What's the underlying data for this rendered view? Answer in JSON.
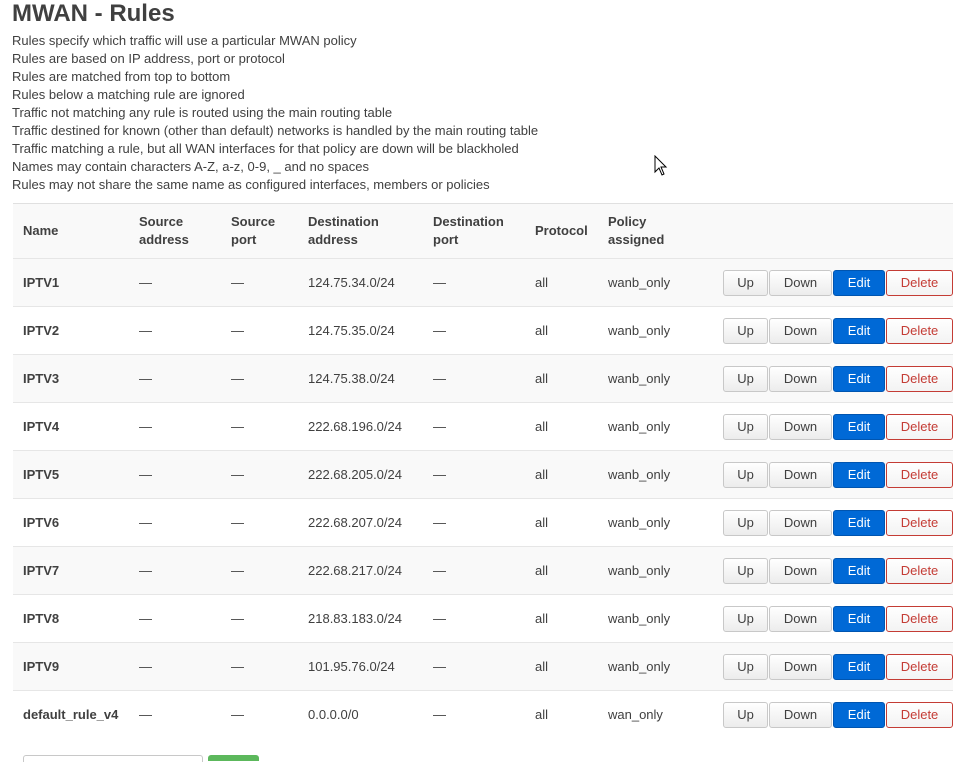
{
  "page": {
    "title": "MWAN - Rules",
    "description": [
      "Rules specify which traffic will use a particular MWAN policy",
      "Rules are based on IP address, port or protocol",
      "Rules are matched from top to bottom",
      "Rules below a matching rule are ignored",
      "Traffic not matching any rule is routed using the main routing table",
      "Traffic destined for known (other than default) networks is handled by the main routing table",
      "Traffic matching a rule, but all WAN interfaces for that policy are down will be blackholed",
      "Names may contain characters A-Z, a-z, 0-9, _ and no spaces",
      "Rules may not share the same name as configured interfaces, members or policies"
    ]
  },
  "table": {
    "headers": {
      "name": "Name",
      "src_addr_1": "Source",
      "src_addr_2": "address",
      "src_port_1": "Source",
      "src_port_2": "port",
      "dest_addr_1": "Destination",
      "dest_addr_2": "address",
      "dest_port_1": "Destination",
      "dest_port_2": "port",
      "protocol": "Protocol",
      "policy_1": "Policy",
      "policy_2": "assigned"
    },
    "buttons": {
      "up": "Up",
      "down": "Down",
      "edit": "Edit",
      "delete": "Delete"
    },
    "rows": [
      {
        "name": "IPTV1",
        "src_addr": "—",
        "src_port": "—",
        "dest_addr": "124.75.34.0/24",
        "dest_port": "—",
        "protocol": "all",
        "policy": "wanb_only"
      },
      {
        "name": "IPTV2",
        "src_addr": "—",
        "src_port": "—",
        "dest_addr": "124.75.35.0/24",
        "dest_port": "—",
        "protocol": "all",
        "policy": "wanb_only"
      },
      {
        "name": "IPTV3",
        "src_addr": "—",
        "src_port": "—",
        "dest_addr": "124.75.38.0/24",
        "dest_port": "—",
        "protocol": "all",
        "policy": "wanb_only"
      },
      {
        "name": "IPTV4",
        "src_addr": "—",
        "src_port": "—",
        "dest_addr": "222.68.196.0/24",
        "dest_port": "—",
        "protocol": "all",
        "policy": "wanb_only"
      },
      {
        "name": "IPTV5",
        "src_addr": "—",
        "src_port": "—",
        "dest_addr": "222.68.205.0/24",
        "dest_port": "—",
        "protocol": "all",
        "policy": "wanb_only"
      },
      {
        "name": "IPTV6",
        "src_addr": "—",
        "src_port": "—",
        "dest_addr": "222.68.207.0/24",
        "dest_port": "—",
        "protocol": "all",
        "policy": "wanb_only"
      },
      {
        "name": "IPTV7",
        "src_addr": "—",
        "src_port": "—",
        "dest_addr": "222.68.217.0/24",
        "dest_port": "—",
        "protocol": "all",
        "policy": "wanb_only"
      },
      {
        "name": "IPTV8",
        "src_addr": "—",
        "src_port": "—",
        "dest_addr": "218.83.183.0/24",
        "dest_port": "—",
        "protocol": "all",
        "policy": "wanb_only"
      },
      {
        "name": "IPTV9",
        "src_addr": "—",
        "src_port": "—",
        "dest_addr": "101.95.76.0/24",
        "dest_port": "—",
        "protocol": "all",
        "policy": "wanb_only"
      },
      {
        "name": "default_rule_v4",
        "src_addr": "—",
        "src_port": "—",
        "dest_addr": "0.0.0.0/0",
        "dest_port": "—",
        "protocol": "all",
        "policy": "wan_only"
      }
    ]
  },
  "colors": {
    "edit": "#0069d6",
    "delete": "#c43c35",
    "text": "#404040"
  },
  "icons": {
    "cursor": "mouse-pointer-icon"
  }
}
